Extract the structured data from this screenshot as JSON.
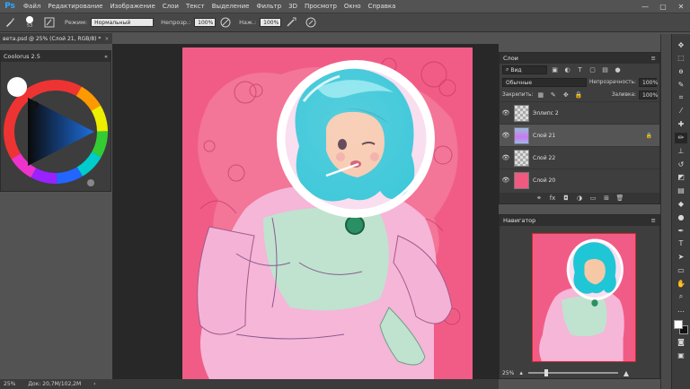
{
  "app": {
    "logo": "Ps"
  },
  "menu": [
    "Файл",
    "Редактирование",
    "Изображение",
    "Слои",
    "Текст",
    "Выделение",
    "Фильтр",
    "3D",
    "Просмотр",
    "Окно",
    "Справка"
  ],
  "window_controls": [
    "—",
    "▢",
    "✕"
  ],
  "options": {
    "brush_size": "53",
    "mode_label": "Режим:",
    "mode_value": "Нормальный",
    "opacity_label": "Непрозр.:",
    "opacity_value": "100%",
    "flow_label": "Наж.:",
    "flow_value": "100%"
  },
  "document_tab": {
    "title": "вета.psd @ 25% (Слой 21, RGB/8) *",
    "close": "×"
  },
  "coolorus": {
    "title": "Coolorus 2.5",
    "close": "«"
  },
  "status": {
    "zoom": "25%",
    "doc": "Док: 20,7M/102,2M",
    "arrow": "›"
  },
  "layers": {
    "title": "Слои",
    "filter": "Вид",
    "blend_mode": "Обычные",
    "opacity_label": "Непрозрачность:",
    "opacity_value": "100%",
    "lock_label": "Закрепить:",
    "fill_label": "Заливка:",
    "fill_value": "100%",
    "items": [
      {
        "name": "Эллипс 2",
        "thumb": "checker",
        "selected": false
      },
      {
        "name": "Слой 21",
        "thumb": "art",
        "selected": true
      },
      {
        "name": "Слой 22",
        "thumb": "checker",
        "selected": false
      },
      {
        "name": "Слой 20",
        "thumb": "#f05a80",
        "selected": false
      }
    ],
    "footer_icons": [
      "link-icon",
      "fx-icon",
      "mask-icon",
      "adjustment-icon",
      "folder-icon",
      "new-layer-icon",
      "trash-icon"
    ]
  },
  "navigator": {
    "title": "Навигатор",
    "zoom": "25%"
  },
  "tools": [
    "move-icon",
    "marquee-icon",
    "lasso-icon",
    "quick-select-icon",
    "crop-icon",
    "eyedropper-icon",
    "healing-icon",
    "brush-icon",
    "stamp-icon",
    "history-brush-icon",
    "eraser-icon",
    "gradient-icon",
    "blur-icon",
    "dodge-icon",
    "pen-icon",
    "type-icon",
    "path-select-icon",
    "rectangle-icon",
    "hand-icon",
    "zoom-icon",
    "more-icon"
  ],
  "colors": {
    "foreground": "#ffffff",
    "background": "#111111",
    "accent": "#31a8ff",
    "pink": "#f15c86"
  }
}
